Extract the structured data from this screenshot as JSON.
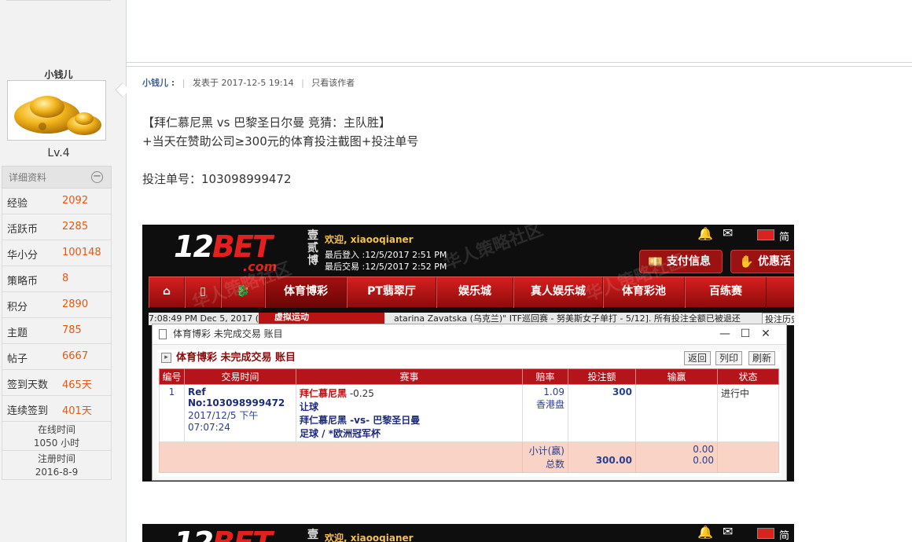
{
  "sidebar": {
    "username": "小钱儿",
    "level": "Lv.4",
    "detail_header": "详细资料",
    "collapse_symbol": "−",
    "stats": [
      {
        "label": "经验",
        "value": "2092"
      },
      {
        "label": "活跃币",
        "value": "2285"
      },
      {
        "label": "华小分",
        "value": "100148"
      },
      {
        "label": "策略币",
        "value": "8"
      },
      {
        "label": "积分",
        "value": "2890"
      },
      {
        "label": "主题",
        "value": "785"
      },
      {
        "label": "帖子",
        "value": "6667"
      },
      {
        "label": "签到天数",
        "value": "465天"
      },
      {
        "label": "连续签到",
        "value": "401天"
      }
    ],
    "online_label": "在线时间",
    "online_value": "1050 小时",
    "register_label": "注册时间",
    "register_value": "2016-8-9"
  },
  "post": {
    "author": "小钱儿 :",
    "posted": "发表于 2017-12-5 19:14",
    "only_author": "只看该作者",
    "line1": "【拜仁慕尼黑 vs 巴黎圣日尔曼 竞猜：主队胜】",
    "line2": "+当天在赞助公司≥300元的体育投注截图+投注单号",
    "line3": "投注单号：103098999472"
  },
  "screenshot": {
    "logo_num": "12",
    "logo_bet": "BET",
    "logo_com": ".com",
    "logo_cn": [
      "壹",
      "贰",
      "博"
    ],
    "welcome": "欢迎, xiaooqianer",
    "last_login": "最后登入 :12/5/2017 2:51 PM",
    "last_trade": "最后交易 :12/5/2017 2:52 PM",
    "lang": "简",
    "pay_info": "支付信息",
    "promo": "优惠活",
    "nav": [
      "体育博彩",
      "PT翡翠厅",
      "娱乐城",
      "真人娱乐城",
      "体育彩池",
      "百练赛"
    ],
    "ticker_time": "7:08:49 PM Dec 5, 2017 (",
    "ticker_tab": "虚拟运动",
    "ticker_text": "atarina Zavatska (乌克兰)\" ITF巡回赛 - 努美斯女子单打 - 5/12]. 所有投注全额已被退还",
    "ticker_btn": "投注历史",
    "window_title": "体育博彩 未完成交易 账目",
    "sub_title": "体育博彩 未完成交易 账目",
    "btn_back": "返回",
    "btn_print": "列印",
    "btn_refresh": "刷新",
    "columns": [
      "编号",
      "交易时间",
      "赛事",
      "赔率",
      "投注额",
      "输赢",
      "状态"
    ],
    "row": {
      "no": "1",
      "ref": "Ref No:103098999472",
      "time": "2017/12/5 下午 07:07:24",
      "team": "拜仁慕尼黑",
      "handicap": "-0.25",
      "bet_type": "让球",
      "match": "拜仁慕尼黑 -vs- 巴黎圣日曼",
      "league": "足球 / *欧洲冠军杯",
      "odds": "1.09",
      "odds_type": "香港盘",
      "stake": "300",
      "status": "进行中"
    },
    "subtotal_label": "小计(赢)",
    "total_label": "总数",
    "subtotal_val": "0.00",
    "total_stake": "300.00",
    "total_val": "0.00",
    "watermark": "华人策略社区"
  },
  "screenshot2": {
    "logo_num": "12",
    "logo_bet": "BET",
    "logo_cn": "壹",
    "welcome": "欢迎, xiaooqianer",
    "lang": "简"
  }
}
